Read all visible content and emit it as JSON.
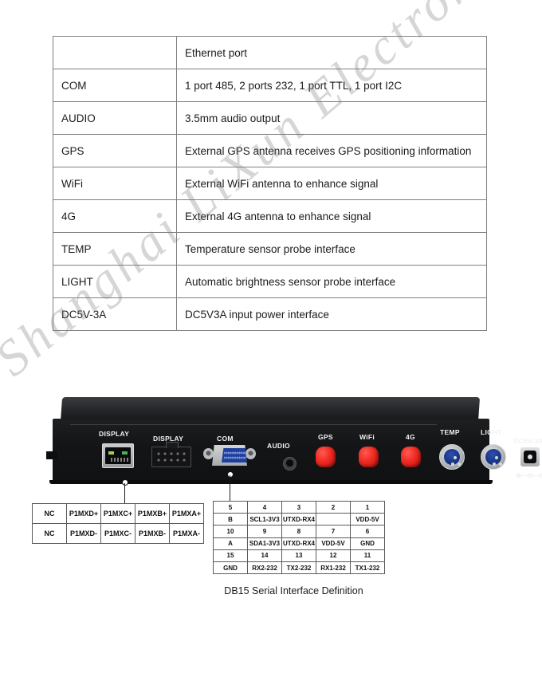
{
  "spec_table": {
    "rows": [
      {
        "name": "",
        "description": "Ethernet port"
      },
      {
        "name": "COM",
        "description": "1 port 485, 2 ports 232, 1 port TTL, 1 port I2C"
      },
      {
        "name": "AUDIO",
        "description": "3.5mm audio output"
      },
      {
        "name": "GPS",
        "description": "External GPS antenna receives GPS positioning information"
      },
      {
        "name": "WiFi",
        "description": "External WiFi antenna to enhance signal"
      },
      {
        "name": "4G",
        "description": "External 4G antenna to enhance signal"
      },
      {
        "name": "TEMP",
        "description": "Temperature sensor probe interface"
      },
      {
        "name": "LIGHT",
        "description": "Automatic brightness sensor probe interface"
      },
      {
        "name": "DC5V-3A",
        "description": "DC5V3A input power interface"
      }
    ]
  },
  "device": {
    "port_labels": {
      "display_rj45": "DISPLAY",
      "display_idc": "DISPLAY",
      "com": "COM",
      "audio": "AUDIO",
      "gps": "GPS",
      "wifi": "WiFi",
      "fourg": "4G",
      "temp": "TEMP",
      "light": "LIGHT",
      "dc": "DC5V-3A"
    },
    "dc_polarity": "⊕—⊖—⊖"
  },
  "display_pin_table": {
    "rows": [
      [
        "NC",
        "P1MXD+",
        "P1MXC+",
        "P1MXB+",
        "P1MXA+"
      ],
      [
        "NC",
        "P1MXD-",
        "P1MXC-",
        "P1MXB-",
        "P1MXA-"
      ]
    ]
  },
  "db15_table": {
    "caption": "DB15 Serial Interface Definition",
    "rows": [
      [
        "5",
        "4",
        "3",
        "2",
        "1"
      ],
      [
        "B",
        "SCL1-3V3",
        "UTXD-RX4",
        "",
        "VDD-5V"
      ],
      [
        "10",
        "9",
        "8",
        "7",
        "6"
      ],
      [
        "A",
        "SDA1-3V3",
        "UTXD-RX4",
        "VDD-5V",
        "GND"
      ],
      [
        "15",
        "14",
        "13",
        "12",
        "11"
      ],
      [
        "GND",
        "RX2-232",
        "TX2-232",
        "RX1-232",
        "TX1-232"
      ]
    ]
  },
  "watermark": {
    "text": "Shanghai LiXun Electronics Co., Ltd."
  },
  "colors": {
    "table_border": "#808080",
    "text": "#1b1b1b",
    "antenna_red": "#ef2a22",
    "vga_blue": "#1f3f9e"
  }
}
